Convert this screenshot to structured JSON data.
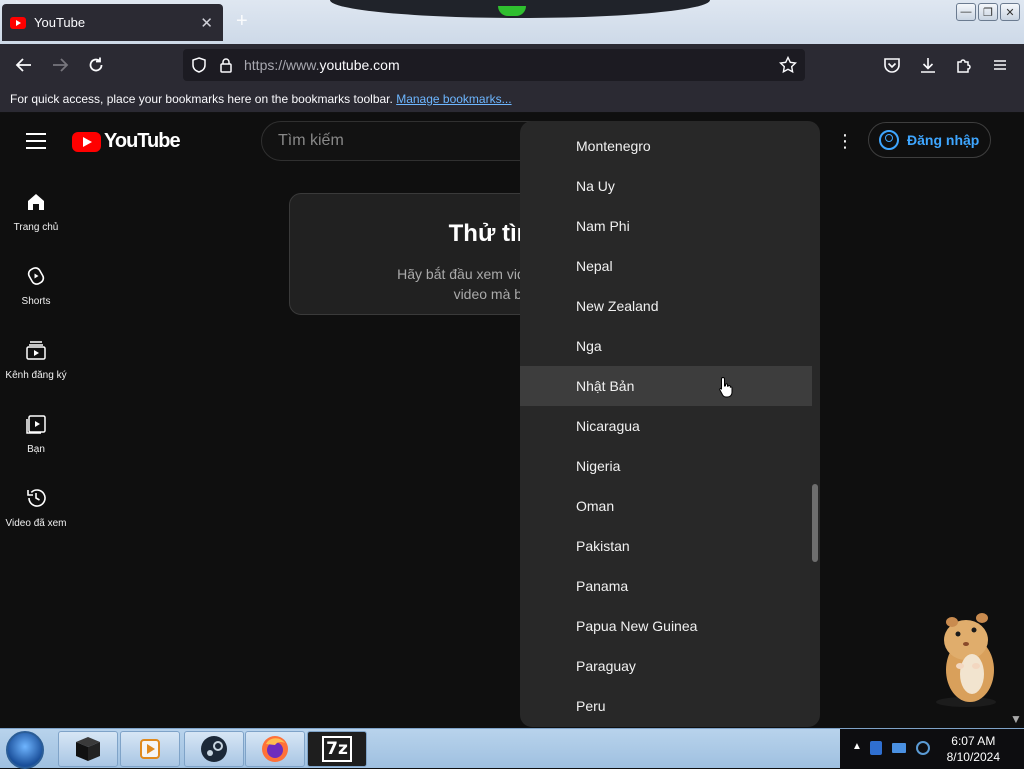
{
  "browser": {
    "tab_title": "YouTube",
    "tab_close": "✕",
    "new_tab": "+",
    "url_prefix": "https://www.",
    "url_domain": "youtube.com",
    "bookmarks_text": "For quick access, place your bookmarks here on the bookmarks toolbar.",
    "bookmarks_link": "Manage bookmarks..."
  },
  "youtube": {
    "logo_text": "YouTube",
    "search_placeholder": "Tìm kiếm",
    "sign_in": "Đăng nhập",
    "guide": [
      {
        "label": "Trang chủ",
        "icon": "home-icon"
      },
      {
        "label": "Shorts",
        "icon": "shorts-icon"
      },
      {
        "label": "Kênh đăng ký",
        "icon": "subscriptions-icon"
      },
      {
        "label": "Bạn",
        "icon": "you-icon"
      },
      {
        "label": "Video đã xem",
        "icon": "history-icon"
      }
    ],
    "card_title": "Thử tìm kiếm",
    "card_text_line1": "Hãy bắt đầu xem video để giúp chúng tôi",
    "card_text_line2": "video mà bạn sẽ thích."
  },
  "dropdown": {
    "items": [
      "Montenegro",
      "Na Uy",
      "Nam Phi",
      "Nepal",
      "New Zealand",
      "Nga",
      "Nhật Bản",
      "Nicaragua",
      "Nigeria",
      "Oman",
      "Pakistan",
      "Panama",
      "Papua New Guinea",
      "Paraguay",
      "Peru"
    ],
    "hovered": "Nhật Bản"
  },
  "taskbar": {
    "time": "6:07 AM",
    "date": "8/10/2024",
    "apps": [
      "terminal",
      "media-player",
      "steam",
      "firefox",
      "7zip"
    ],
    "sevenzip_label": "7z"
  },
  "colors": {
    "yt_red": "#ff0000",
    "link_blue": "#3ea6ff",
    "background": "#0f0f0f"
  }
}
